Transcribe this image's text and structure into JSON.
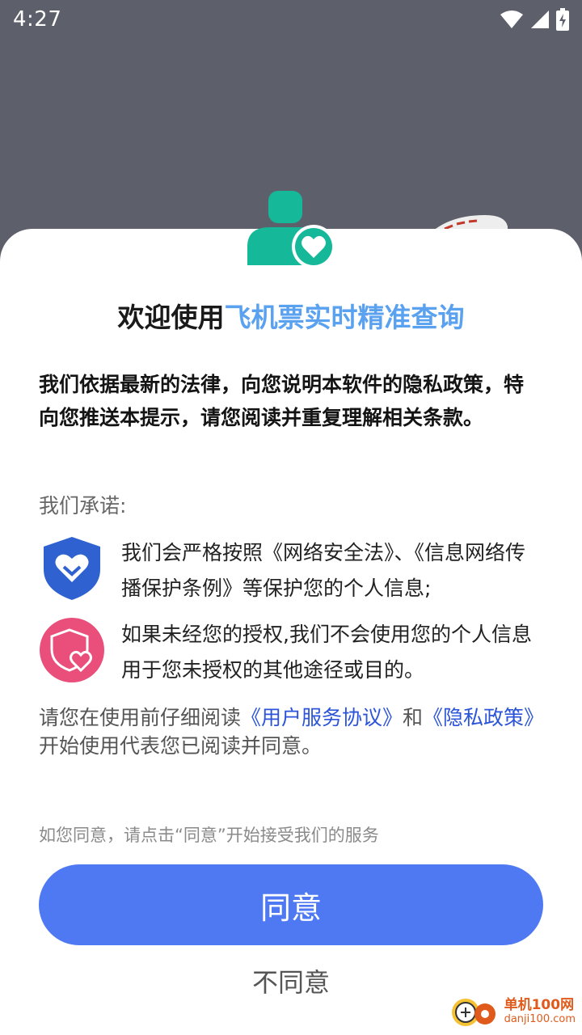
{
  "status_bar": {
    "time": "4:27"
  },
  "dialog": {
    "title_prefix": "欢迎使用",
    "title_app_name": "飞机票实时精准查询",
    "intro": "我们依据最新的法律，向您说明本软件的隐私政策，特向您推送本提示，请您阅读并重复理解相关条款。",
    "promise_title": "我们承诺:",
    "promises": [
      {
        "icon": "shield-heart-icon",
        "text": "我们会严格按照《网络安全法》、《信息网络传播保护条例》等保护您的个人信息;"
      },
      {
        "icon": "heart-shield-icon",
        "text": "如果未经您的授权,我们不会使用您的个人信息用于您未授权的其他途径或目的。"
      }
    ],
    "notice": {
      "prefix": "请您在使用前仔细阅读",
      "user_agreement_link": "《用户服务协议》",
      "conjunction": "和",
      "privacy_policy_link": "《隐私政策》",
      "suffix": "开始使用代表您已阅读并同意。"
    },
    "hint": "如您同意，请点击“同意”开始接受我们的服务",
    "agree_label": "同意",
    "disagree_label": "不同意"
  },
  "watermark": {
    "name": "单机100网",
    "url": "danji100.com"
  },
  "colors": {
    "accent_blue": "#4f79f3",
    "app_name_blue": "#5aa2f0",
    "link_blue": "#2b54d8",
    "icon_green": "#16b89a",
    "shield_blue": "#2f62d0",
    "heart_pink": "#ea4f7c"
  }
}
